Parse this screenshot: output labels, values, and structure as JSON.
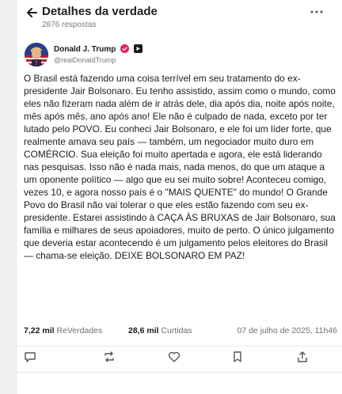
{
  "header": {
    "title": "Detalhes da verdade",
    "subtitle": "2876 respostas",
    "back_icon": "arrow-left-icon",
    "more_icon": "more-horizontal-icon"
  },
  "author": {
    "name": "Donald J. Trump",
    "handle": "@realDonaldTrump",
    "verified_color": "#e0245e"
  },
  "post": {
    "text": "O Brasil está fazendo uma coisa terrível em seu tratamento do ex-presidente Jair Bolsonaro. Eu tenho assistido, assim como o mundo, como eles não fizeram nada além de ir atrás dele, dia após dia, noite após noite, mês após mês, ano após ano! Ele não é culpado de nada, exceto por ter lutado pelo POVO. Eu conheci Jair Bolsonaro, e ele foi um líder forte, que realmente amava seu país — também, um negociador muito duro em COMÉRCIO. Sua eleição foi muito apertada e agora, ele está liderando nas pesquisas. Isso não é nada mais, nada menos, do que um ataque a um oponente político — algo que eu sei muito sobre! Aconteceu comigo, vezes 10, e agora nosso país é o \"MAIS QUENTE\" do mundo! O Grande Povo do Brasil não vai tolerar o que eles estão fazendo com seu ex-presidente. Estarei assistindo à CAÇA ÀS BRUXAS de Jair Bolsonaro, sua família e milhares de seus apoiadores, muito de perto. O único julgamento que deveria estar acontecendo é um julgamento pelos eleitores do Brasil — chama-se eleição. DEIXE BOLSONARO EM PAZ!"
  },
  "stats": {
    "retruths_count": "7,22 mil",
    "retruths_label": "ReVerdades",
    "likes_count": "28,6 mil",
    "likes_label": "Curtidas",
    "date": "07 de julho de 2025, 11h46"
  },
  "actions": {
    "icons": [
      "reply-icon",
      "retruth-icon",
      "like-icon",
      "bookmark-icon",
      "share-icon"
    ]
  }
}
